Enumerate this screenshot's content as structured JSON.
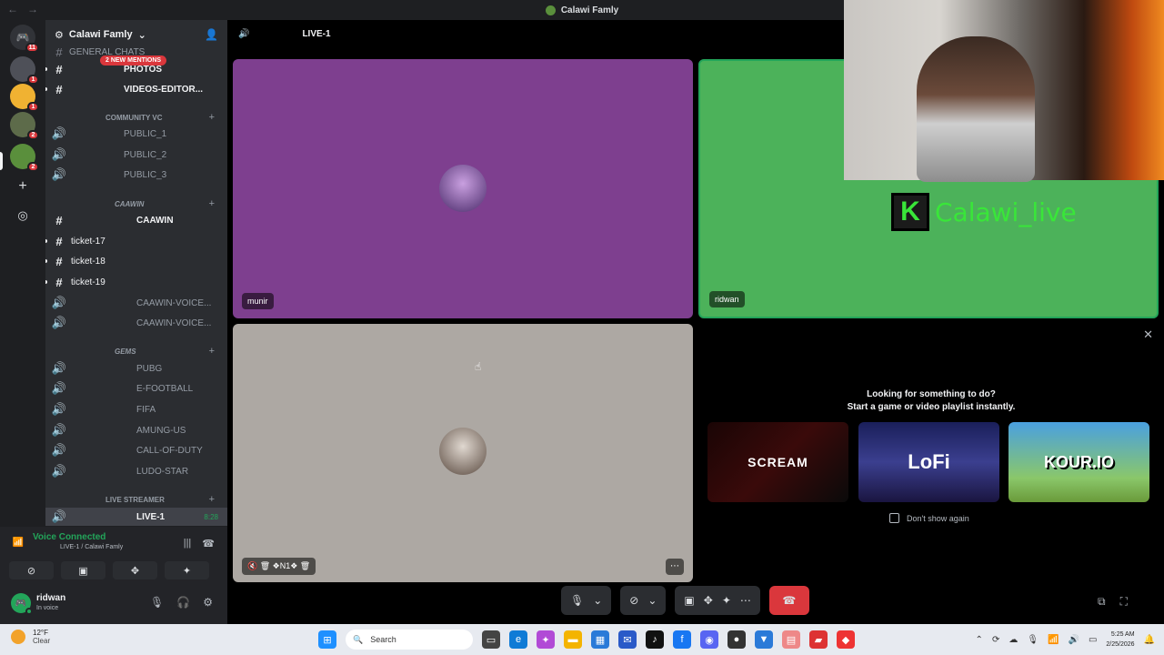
{
  "window": {
    "title": "Calawi Famly"
  },
  "rail": {
    "badges": [
      "11",
      "1",
      "1",
      "2",
      "2"
    ]
  },
  "server": {
    "name": "Calawi Famly"
  },
  "mentions": "2 NEW MENTIONS",
  "channels": {
    "c0": "GENERAL CHATS",
    "c1": "PHOTOS",
    "c2": "VIDEOS-EDITOR...",
    "cat1": "COMMUNITY VC",
    "c3": "PUBLIC_1",
    "c4": "PUBLIC_2",
    "c5": "PUBLIC_3",
    "cat2": "CAAWIN",
    "c6": "CAAWIN",
    "c7": "ticket-17",
    "c8": "ticket-18",
    "c9": "ticket-19",
    "c10": "CAAWIN-VOICE...",
    "c11": "CAAWIN-VOICE...",
    "cat3": "GEMS",
    "c12": "PUBG",
    "c13": "E-FOOTBALL",
    "c14": "FIFA",
    "c15": "AMUNG-US",
    "c16": "CALL-OF-DUTY",
    "c17": "LUDO-STAR",
    "cat4": "LIVE STREAMER",
    "c18": "LIVE-1",
    "c18_time": "8:28"
  },
  "voice": {
    "status": "Voice Connected",
    "location": "LIVE-1 / Calawi Famly"
  },
  "user": {
    "name": "ridwan",
    "status": "In voice"
  },
  "stage": {
    "channel": "LIVE-1",
    "tile1_name": "munir",
    "tile2_name": "ridwan",
    "tile3_tag": "N1",
    "overlay_text": "Calawi_live"
  },
  "activity": {
    "heading": "Looking for something to do?",
    "subheading": "Start a game or video playlist instantly.",
    "card1": "SCREAM",
    "card2": "LoFi",
    "card3": "KOUR.IO",
    "dont_show": "Don't show again"
  },
  "taskbar": {
    "temp": "12°F",
    "weather": "Clear",
    "search": "Search",
    "time": "5:25 AM",
    "date": "2/25/2026"
  },
  "colors": {
    "accent": "#5865f2",
    "green": "#23a55a",
    "red": "#da373c",
    "tile1": "#7e3f8f",
    "tile2": "#4cb25a",
    "tile3": "#ada8a3"
  }
}
